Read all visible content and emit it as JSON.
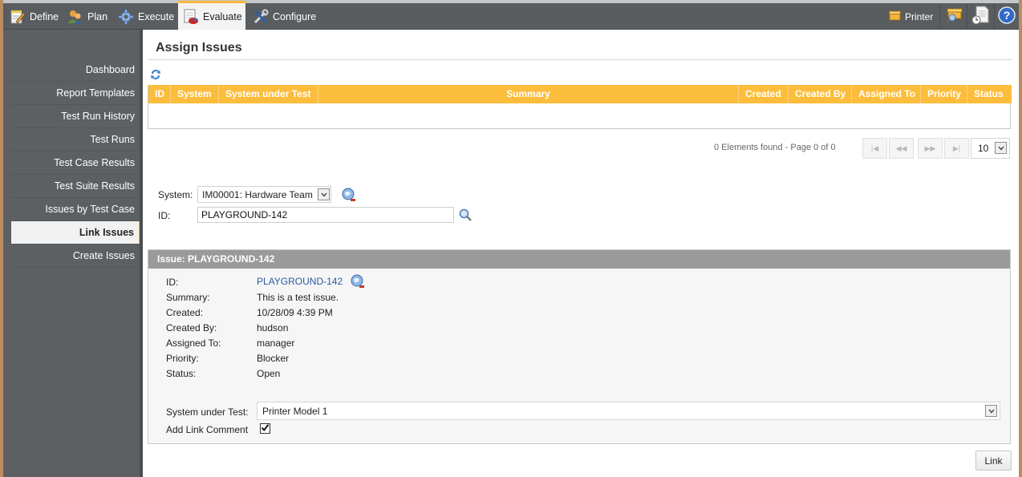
{
  "topnav": {
    "items": [
      {
        "label": "Define",
        "icon": "notepad-pencil-icon",
        "active": false
      },
      {
        "label": "Plan",
        "icon": "people-icon",
        "active": false
      },
      {
        "label": "Execute",
        "icon": "gear-icon",
        "active": false
      },
      {
        "label": "Evaluate",
        "icon": "report-chart-icon",
        "active": true
      },
      {
        "label": "Configure",
        "icon": "tools-icon",
        "active": false
      }
    ],
    "project_label": "Printer",
    "project_icon": "box-icon",
    "right_icons": [
      "browse-projects-icon",
      "history-report-icon",
      "help-icon"
    ]
  },
  "sidebar": {
    "items": [
      {
        "label": "Dashboard",
        "active": false
      },
      {
        "label": "Report Templates",
        "active": false
      },
      {
        "label": "Test Run History",
        "active": false
      },
      {
        "label": "Test Runs",
        "active": false
      },
      {
        "label": "Test Case Results",
        "active": false
      },
      {
        "label": "Test Suite Results",
        "active": false
      },
      {
        "label": "Issues by Test Case",
        "active": false
      },
      {
        "label": "Link Issues",
        "active": true
      },
      {
        "label": "Create Issues",
        "active": false
      }
    ]
  },
  "main": {
    "title": "Assign Issues",
    "grid": {
      "columns": [
        "ID",
        "System",
        "System under Test",
        "Summary",
        "Created",
        "Created By",
        "Assigned To",
        "Priority",
        "Status"
      ],
      "rows": []
    },
    "pager": {
      "status": "0 Elements found - Page 0 of 0",
      "first": "|◀",
      "prev": "◀◀",
      "next": "▶▶",
      "last": "▶|",
      "page_size": "10"
    },
    "search": {
      "system_label": "System:",
      "system_value": "IM00001: Hardware Team",
      "id_label": "ID:",
      "id_value": "PLAYGROUND-142"
    },
    "issue": {
      "header": "Issue: PLAYGROUND-142",
      "fields": [
        {
          "label": "ID:",
          "value": "PLAYGROUND-142",
          "link": true
        },
        {
          "label": "Summary:",
          "value": "This is a test issue."
        },
        {
          "label": "Created:",
          "value": "10/28/09 4:39 PM"
        },
        {
          "label": "Created By:",
          "value": "hudson"
        },
        {
          "label": "Assigned To:",
          "value": "manager"
        },
        {
          "label": "Priority:",
          "value": "Blocker"
        },
        {
          "label": "Status:",
          "value": "Open"
        }
      ],
      "sut_label": "System under Test:",
      "sut_value": "Printer Model 1",
      "comment_label": "Add Link Comment",
      "comment_checked": true
    },
    "link_button": "Link"
  },
  "colors": {
    "accent": "#f6b73c",
    "grid_header": "#fdbd3c",
    "nav_bg": "#5a5d60",
    "panel_header": "#9a9a9a",
    "link": "#2a5aa0"
  }
}
